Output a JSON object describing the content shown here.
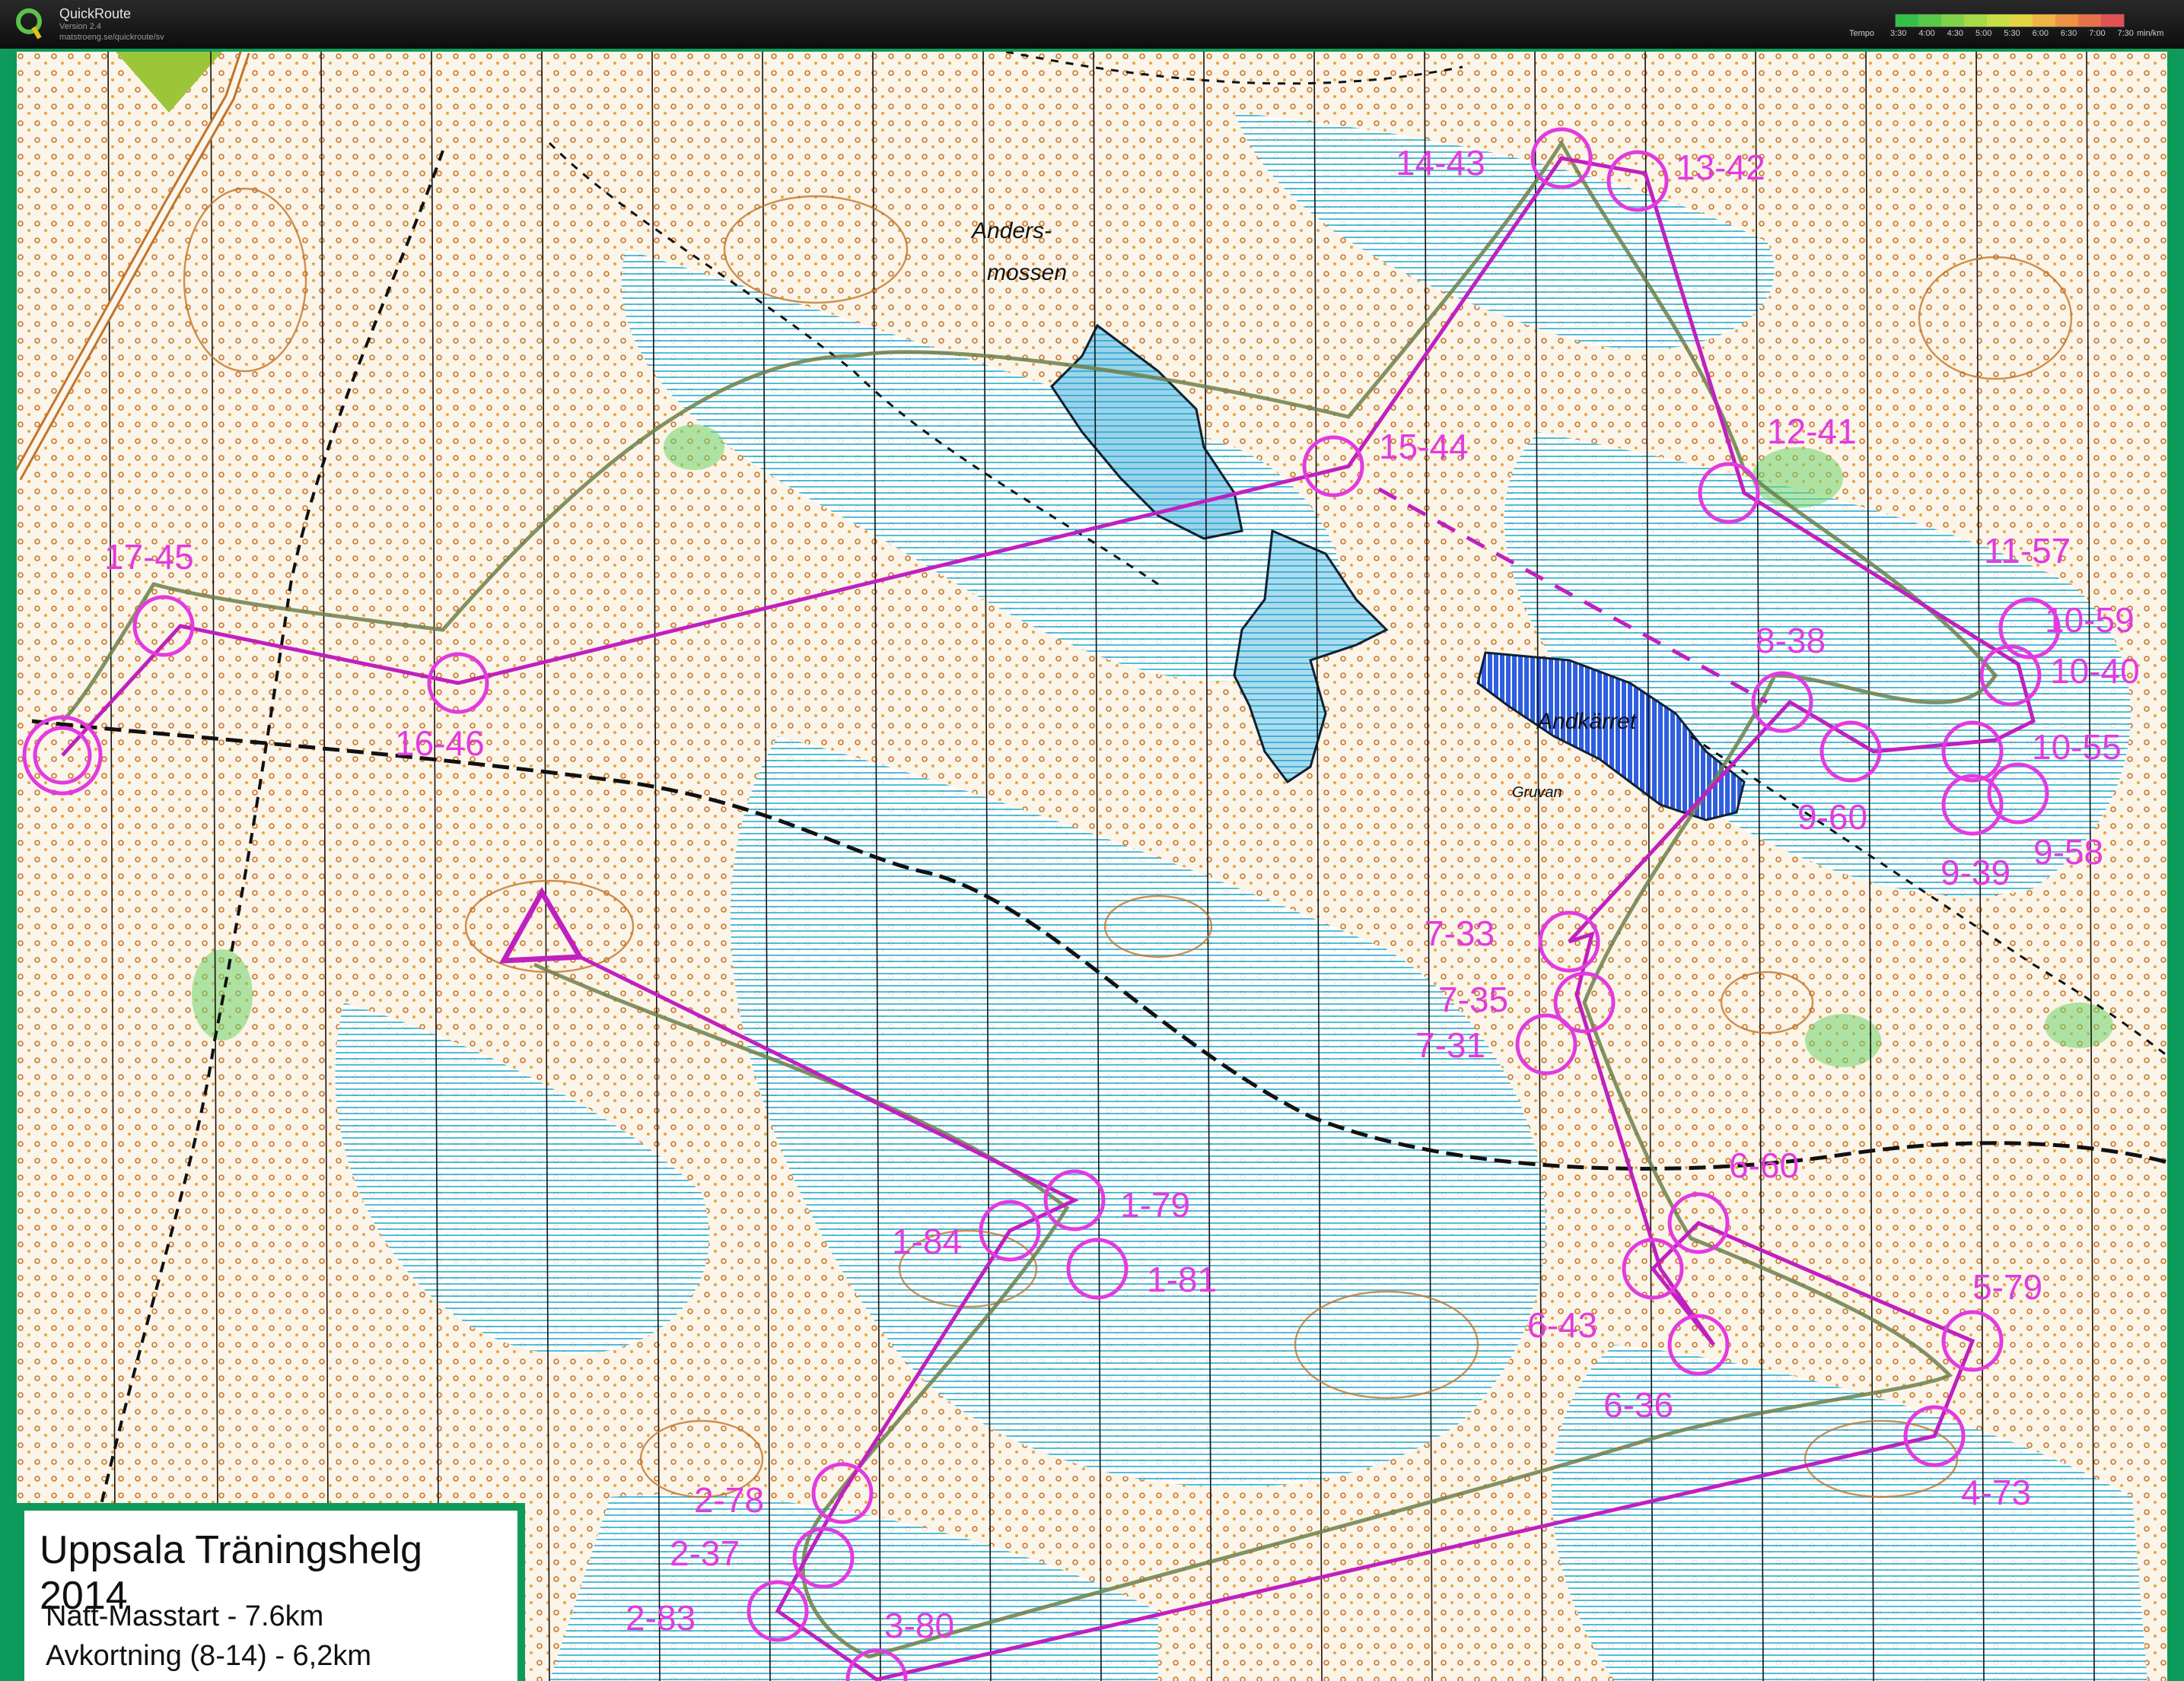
{
  "app": {
    "name": "QuickRoute",
    "version": "Version 2.4",
    "url": "matstroeng.se/quickroute/sv",
    "tempo_label": "Tempo",
    "tempo_ticks": [
      "3:30",
      "4:00",
      "4:30",
      "5:00",
      "5:30",
      "6:00",
      "6:30",
      "7:00",
      "7:30"
    ],
    "tempo_unit": "min/km",
    "tempo_colors": [
      "#35c04b",
      "#58c84a",
      "#7fd24a",
      "#a5d948",
      "#c8de46",
      "#e4d444",
      "#eeb444",
      "#ee9144",
      "#e8714a",
      "#e25254"
    ]
  },
  "info": {
    "title": "Uppsala Träningshelg 2014",
    "line1": "Natt-Masstart - 7.6km",
    "line2": "Avkortning (8-14) - 6,2km"
  },
  "places": [
    {
      "id": "andersmossen-1",
      "text": "Anders-"
    },
    {
      "id": "andersmossen-2",
      "text": "mossen"
    },
    {
      "id": "andkarret",
      "text": "Andkärret"
    },
    {
      "id": "gruvan",
      "text": "Gruvan"
    }
  ],
  "controls": [
    {
      "label": "1-79"
    },
    {
      "label": "1-84"
    },
    {
      "label": "1-81"
    },
    {
      "label": "2-78"
    },
    {
      "label": "2-37"
    },
    {
      "label": "2-83"
    },
    {
      "label": "3-80"
    },
    {
      "label": "4-73"
    },
    {
      "label": "5-79"
    },
    {
      "label": "6-60"
    },
    {
      "label": "6-43"
    },
    {
      "label": "6-36"
    },
    {
      "label": "7-33"
    },
    {
      "label": "7-35"
    },
    {
      "label": "7-31"
    },
    {
      "label": "8-38"
    },
    {
      "label": "9-60"
    },
    {
      "label": "9-39"
    },
    {
      "label": "9-58"
    },
    {
      "label": "10-55"
    },
    {
      "label": "10-40"
    },
    {
      "label": "10-59"
    },
    {
      "label": "11-57"
    },
    {
      "label": "12-41"
    },
    {
      "label": "13-42"
    },
    {
      "label": "14-43"
    },
    {
      "label": "15-44"
    },
    {
      "label": "16-46"
    },
    {
      "label": "17-45"
    }
  ],
  "colors": {
    "route": "#e23ae0",
    "course": "#c020c0",
    "water": "#2a9fd0",
    "frame": "#0e9a5a"
  }
}
